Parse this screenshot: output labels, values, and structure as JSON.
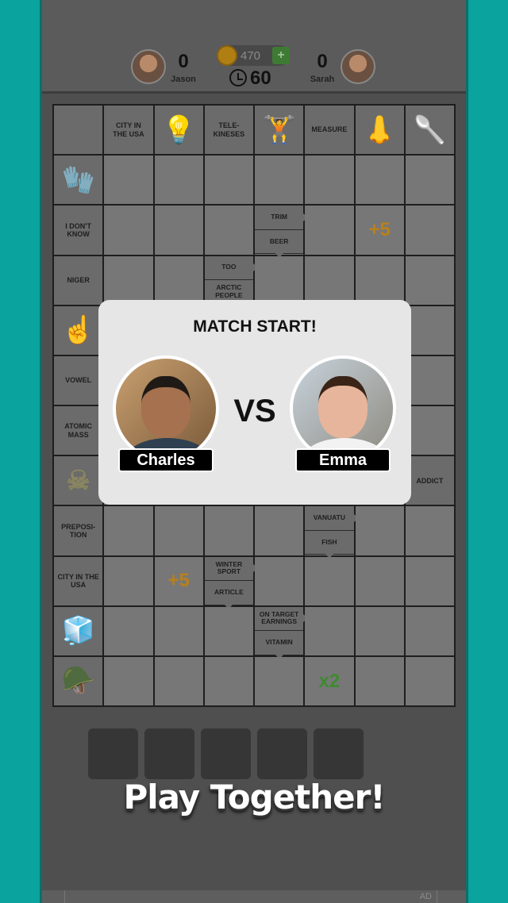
{
  "header": {
    "left_player": {
      "name": "Jason",
      "score": "0"
    },
    "right_player": {
      "name": "Sarah",
      "score": "0"
    },
    "coins": "470",
    "add_coins": "+",
    "timer": "60"
  },
  "colors": {
    "side": "#0aa39d",
    "bonus_orange": "#b8801c",
    "bonus_green": "#3f8a30"
  },
  "grid": {
    "rows": [
      [
        {
          "t": "empty"
        },
        {
          "t": "clue",
          "text": "CITY IN\nTHE USA"
        },
        {
          "t": "icon",
          "icon": "lightbulb-head-icon"
        },
        {
          "t": "clue",
          "text": "TELE-\nKINESES"
        },
        {
          "t": "icon",
          "icon": "dumbbell-icon"
        },
        {
          "t": "clue",
          "text": "MEASURE"
        },
        {
          "t": "icon",
          "icon": "nose-icon"
        },
        {
          "t": "icon",
          "icon": "spoon-icon"
        }
      ],
      [
        {
          "t": "icon",
          "icon": "mittens-icon"
        },
        {},
        {},
        {},
        {},
        {},
        {},
        {}
      ],
      [
        {
          "t": "clue",
          "text": "I DON'T\nKNOW"
        },
        {},
        {},
        {},
        {
          "t": "split",
          "a": "TRIM",
          "b": "BEER"
        },
        {},
        {
          "t": "bonus",
          "text": "+5",
          "color": "orange"
        },
        {}
      ],
      [
        {
          "t": "clue",
          "text": "NIGER"
        },
        {},
        {},
        {
          "t": "split",
          "a": "TOO",
          "b": "ARCTIC\nPEOPLE"
        },
        {},
        {},
        {},
        {}
      ],
      [
        {
          "t": "icon",
          "icon": "fingernail-icon"
        },
        {},
        {},
        {},
        {},
        {},
        {},
        {}
      ],
      [
        {
          "t": "clue",
          "text": "VOWEL"
        },
        {},
        {},
        {},
        {},
        {},
        {},
        {}
      ],
      [
        {
          "t": "clue",
          "text": "ATOMIC\nMASS"
        },
        {},
        {},
        {},
        {},
        {},
        {},
        {}
      ],
      [
        {
          "t": "icon",
          "icon": "skull-crossbones-icon"
        },
        {},
        {},
        {},
        {},
        {},
        {},
        {
          "t": "clue",
          "text": "ADDICT"
        }
      ],
      [
        {
          "t": "clue",
          "text": "PREPOSI-\nTION"
        },
        {},
        {},
        {},
        {},
        {
          "t": "split",
          "a": "VANUATU",
          "b": "FISH"
        },
        {},
        {}
      ],
      [
        {
          "t": "clue",
          "text": "CITY IN THE\nUSA"
        },
        {},
        {
          "t": "bonus",
          "text": "+5",
          "color": "orange"
        },
        {
          "t": "split",
          "a": "WINTER\nSPORT",
          "b": "ARTICLE"
        },
        {},
        {},
        {},
        {}
      ],
      [
        {
          "t": "icon",
          "icon": "ice-cubes-icon"
        },
        {},
        {},
        {},
        {
          "t": "split",
          "a": "ON TARGET\nEARNINGS",
          "b": "VITAMIN"
        },
        {},
        {},
        {}
      ],
      [
        {
          "t": "icon",
          "icon": "military-cap-icon"
        },
        {},
        {},
        {},
        {},
        {
          "t": "bonus",
          "text": "x2",
          "color": "green"
        },
        {},
        {}
      ]
    ]
  },
  "modal": {
    "title": "MATCH START!",
    "player1": "Charles",
    "player2": "Emma",
    "vs": "VS"
  },
  "answer_tiles": 5,
  "tagline": "Play Together!",
  "ad": {
    "label": "AD"
  }
}
